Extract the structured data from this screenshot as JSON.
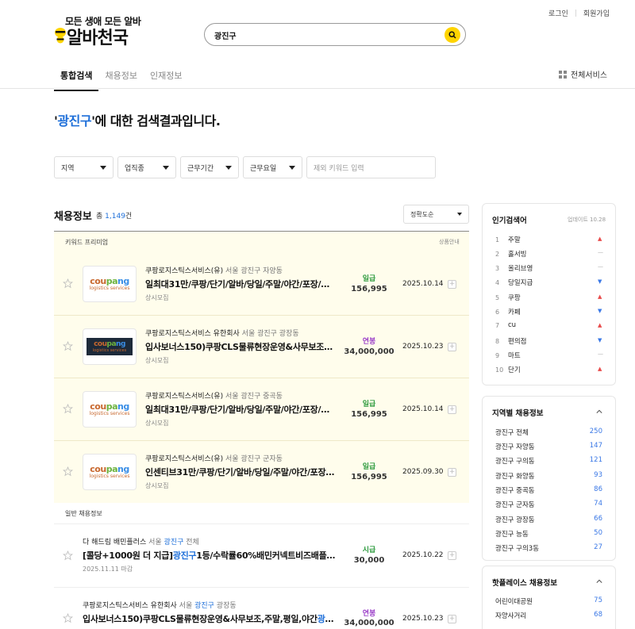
{
  "header": {
    "logo_tagline": "모든 생애 모든 알바",
    "logo_name": "알바천국",
    "search_value": "광진구",
    "login": "로그인",
    "signup": "회원가입"
  },
  "tabs": [
    {
      "label": "통합검색",
      "active": true
    },
    {
      "label": "채용정보",
      "active": false
    },
    {
      "label": "인재정보",
      "active": false
    }
  ],
  "all_services": "전체서비스",
  "result": {
    "quote_open": "'",
    "keyword": "광진구",
    "rest": "'에 대한 검색결과입니다."
  },
  "filters": {
    "region": "지역",
    "job": "업직종",
    "period": "근무기간",
    "days": "근무요일",
    "exclude_placeholder": "제외 키워드 입력"
  },
  "jobs": {
    "title": "채용정보",
    "count_prefix": "총",
    "count": "1,149",
    "count_suffix": "건",
    "sort": "정확도순",
    "premium_label": "키워드 프리미엄",
    "premium_guide": "상품안내",
    "general_label": "일반 채용정보",
    "premium_rows": [
      {
        "company": "쿠팡로지스틱스서비스(유)",
        "location": "서울 광진구 자양동",
        "title": "일최대31만/쿠팡/단기/알바/당일/주말/야간/포장/주...",
        "sub": "상시모집",
        "pay_type": "일급",
        "pay": "156,995",
        "date": "2025.10.14",
        "logo": "coupang"
      },
      {
        "company": "쿠팡로지스틱스서비스 유한회사",
        "location": "서울 광진구 광장동",
        "title": "입사보너스150)쿠팡CLS물류현장운영&사무보조,주...",
        "sub": "상시모집",
        "pay_type": "연봉",
        "pay": "34,000,000",
        "date": "2025.10.23",
        "logo": "coupang-dark"
      },
      {
        "company": "쿠팡로지스틱스서비스(유)",
        "location": "서울 광진구 중곡동",
        "title": "일최대31만/쿠팡/단기/알바/당일/주말/야간/포장/주...",
        "sub": "상시모집",
        "pay_type": "일급",
        "pay": "156,995",
        "date": "2025.10.14",
        "logo": "coupang"
      },
      {
        "company": "쿠팡로지스틱스서비스(유)",
        "location": "서울 광진구 군자동",
        "title": "인센티브31만/쿠팡/단기/알바/당일/주말/야간/포장/...",
        "sub": "상시모집",
        "pay_type": "일급",
        "pay": "156,995",
        "date": "2025.09.30",
        "logo": "coupang"
      }
    ],
    "general_rows": [
      {
        "company": "다 해드림 배민플러스",
        "loc_pre": "서울 ",
        "loc_hl": "광진구",
        "loc_post": " 전체",
        "title_pre": "[콜당+1000원 더 지급]",
        "title_hl": "광진구",
        "title_post": "1등/수락률60%배민커넥트비즈배플배민...",
        "sub": "2025.11.11 마감",
        "pay_type": "시급",
        "pay": "30,000",
        "date": "2025.10.22"
      },
      {
        "company": "쿠팡로지스틱스서비스 유한회사",
        "loc_pre": "서울 ",
        "loc_hl": "광진구",
        "loc_post": " 광장동",
        "title_pre": "입사보너스150)쿠팡CLS물류현장운영&사무보조,주말,평일,야간",
        "title_hl": "광진구",
        "title_post": "...",
        "sub": "",
        "pay_type": "연봉",
        "pay": "34,000,000",
        "date": "2025.10.23"
      }
    ]
  },
  "popular": {
    "title": "인기검색어",
    "updated": "업데이트 10.28",
    "items": [
      {
        "rank": "1",
        "term": "주말",
        "trend": "up"
      },
      {
        "rank": "2",
        "term": "홀서빙",
        "trend": "same"
      },
      {
        "rank": "3",
        "term": "올리브영",
        "trend": "same"
      },
      {
        "rank": "4",
        "term": "당일지급",
        "trend": "down"
      },
      {
        "rank": "5",
        "term": "쿠팡",
        "trend": "up"
      },
      {
        "rank": "6",
        "term": "카페",
        "trend": "down"
      },
      {
        "rank": "7",
        "term": "cu",
        "trend": "up"
      },
      {
        "rank": "8",
        "term": "편의점",
        "trend": "down"
      },
      {
        "rank": "9",
        "term": "마트",
        "trend": "same"
      },
      {
        "rank": "10",
        "term": "단기",
        "trend": "up"
      }
    ]
  },
  "regional": {
    "title": "지역별 채용정보",
    "items": [
      {
        "name": "광진구 전체",
        "count": "250"
      },
      {
        "name": "광진구 자양동",
        "count": "147"
      },
      {
        "name": "광진구 구의동",
        "count": "121"
      },
      {
        "name": "광진구 화양동",
        "count": "93"
      },
      {
        "name": "광진구 중곡동",
        "count": "86"
      },
      {
        "name": "광진구 군자동",
        "count": "74"
      },
      {
        "name": "광진구 광장동",
        "count": "66"
      },
      {
        "name": "광진구 능동",
        "count": "50"
      },
      {
        "name": "광진구 구의3동",
        "count": "27"
      }
    ]
  },
  "hotplace": {
    "title": "핫플레이스 채용정보",
    "items": [
      {
        "name": "어린이대공원",
        "count": "75"
      },
      {
        "name": "자양사거리",
        "count": "68"
      }
    ]
  },
  "colors": {
    "accent": "#ffd400",
    "keyword": "#1e6fd9",
    "premium_bg": "#fffdec",
    "daily": "#2e9b3f",
    "yearly": "#9b3fc8"
  }
}
